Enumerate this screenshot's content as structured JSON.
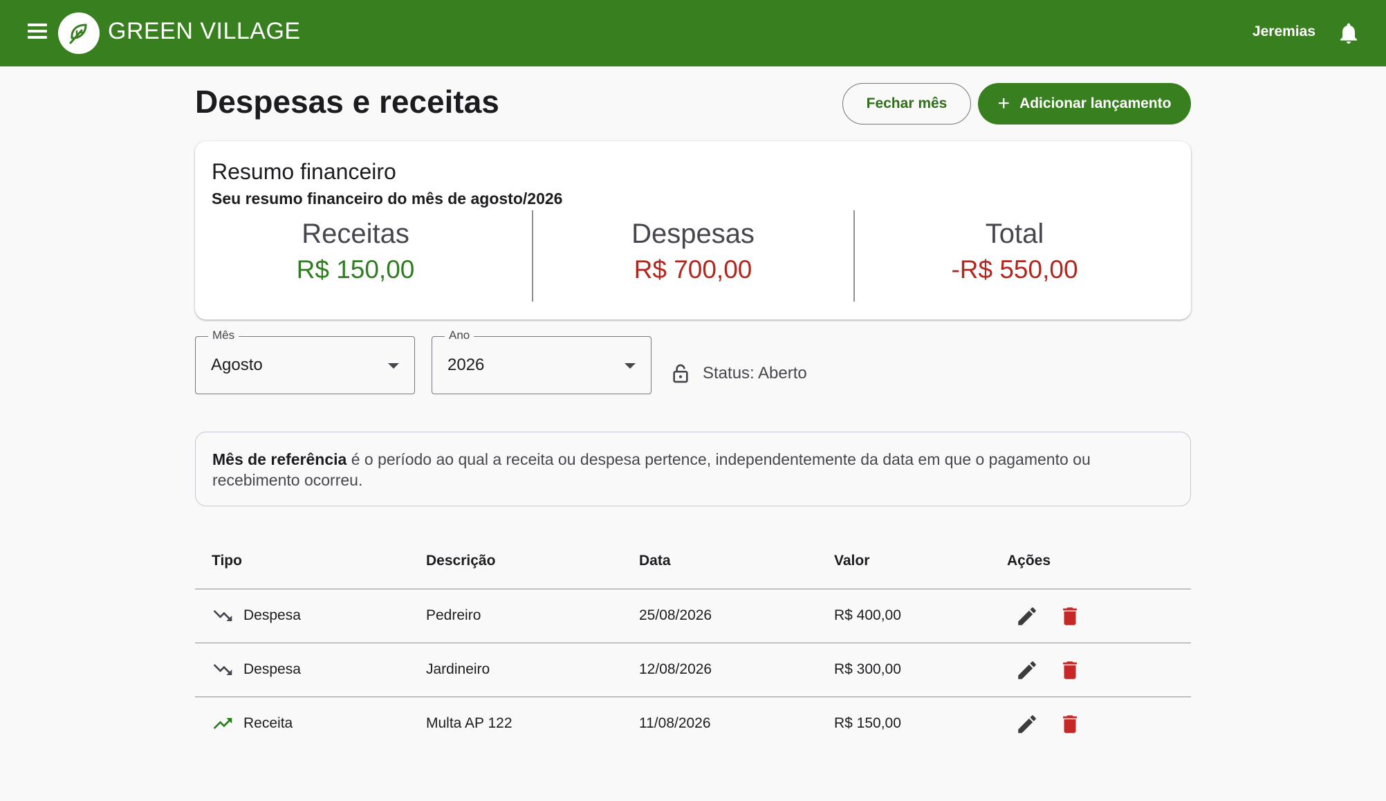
{
  "header": {
    "brand": "GREEN VILLAGE",
    "user": "Jeremias",
    "color": "#38801f"
  },
  "page": {
    "title": "Despesas e receitas",
    "close_month_label": "Fechar mês",
    "add_entry_label": "Adicionar lançamento"
  },
  "summary": {
    "title": "Resumo financeiro",
    "subtitle": "Seu resumo financeiro do mês de agosto/2026",
    "income_label": "Receitas",
    "income_value": "R$ 150,00",
    "expense_label": "Despesas",
    "expense_value": "R$ 700,00",
    "total_label": "Total",
    "total_value": "-R$ 550,00"
  },
  "filters": {
    "month_label": "Mês",
    "month_value": "Agosto",
    "year_label": "Ano",
    "year_value": "2026",
    "status_text": "Status: Aberto"
  },
  "info": {
    "bold": "Mês de referência",
    "text": " é o período ao qual a receita ou despesa pertence, independentemente da data em que o pagamento ou recebimento ocorreu."
  },
  "table": {
    "headers": {
      "tipo": "Tipo",
      "descricao": "Descrição",
      "data": "Data",
      "valor": "Valor",
      "acoes": "Ações"
    },
    "rows": [
      {
        "tipo": "Despesa",
        "icon": "trending-down-icon",
        "descricao": "Pedreiro",
        "data": "25/08/2026",
        "valor": "R$ 400,00"
      },
      {
        "tipo": "Despesa",
        "icon": "trending-down-icon",
        "descricao": "Jardineiro",
        "data": "12/08/2026",
        "valor": "R$ 300,00"
      },
      {
        "tipo": "Receita",
        "icon": "trending-up-icon",
        "descricao": "Multa AP 122",
        "data": "11/08/2026",
        "valor": "R$ 150,00"
      }
    ]
  }
}
